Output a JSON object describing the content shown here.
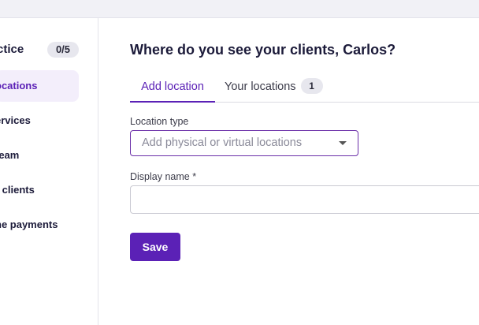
{
  "sidebar": {
    "title": "ctice",
    "progress_badge": "0/5",
    "items": [
      {
        "label": "ocations",
        "active": true
      },
      {
        "label": "ervices",
        "active": false
      },
      {
        "label": "team",
        "active": false
      },
      {
        "label": "r clients",
        "active": false
      },
      {
        "label": "ne payments",
        "active": false
      }
    ]
  },
  "main": {
    "heading": "Where do you see your clients, Carlos?",
    "tabs": [
      {
        "label": "Add location",
        "active": true
      },
      {
        "label": "Your locations",
        "count": "1",
        "active": false
      }
    ],
    "form": {
      "location_type_label": "Location type",
      "location_type_placeholder": "Add physical or virtual locations",
      "display_name_label": "Display name *",
      "display_name_value": "",
      "save_label": "Save"
    }
  },
  "colors": {
    "accent": "#5b21b6",
    "active_item_bg": "#f3eefb",
    "badge_bg": "#e7e7ee",
    "topbar_bg": "#f1f1f6"
  },
  "icons": {
    "select_caret": "chevron-down-icon"
  }
}
